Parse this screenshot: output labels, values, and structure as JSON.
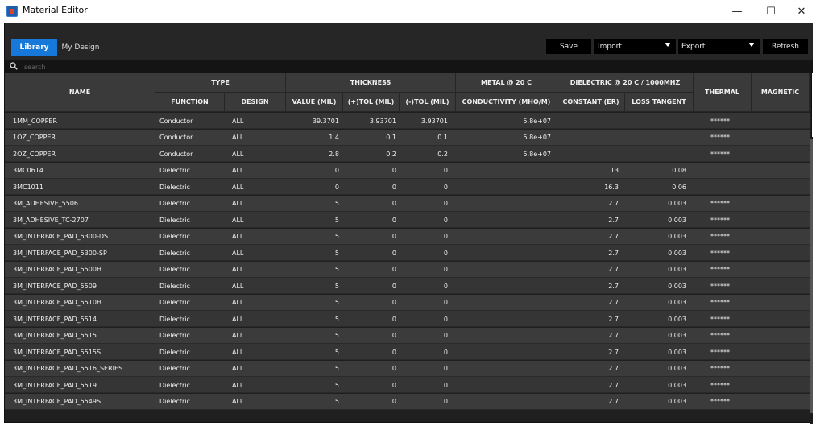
{
  "window": {
    "title": "Material Editor",
    "minimize": "—",
    "maximize": "☐",
    "close": "✕"
  },
  "tabs": [
    {
      "label": "Library"
    },
    {
      "label": "My Design"
    }
  ],
  "toolbar": {
    "save": "Save",
    "import": "Import",
    "export": "Export",
    "refresh": "Refresh"
  },
  "search": {
    "placeholder": "search"
  },
  "header": {
    "name": "NAME",
    "type": "TYPE",
    "thickness": "THICKNESS",
    "metal": "METAL @ 20 C",
    "dielectric": "DIELECTRIC @ 20 C / 1000MHZ",
    "thermal": "THERMAL",
    "magnetic": "MAGNETIC",
    "function": "FUNCTION",
    "design": "DESIGN",
    "value": "VALUE (MIL)",
    "plus_tol": "(+)TOL (MIL)",
    "minus_tol": "(-)TOL (MIL)",
    "conductivity": "CONDUCTIVITY (MHO/M)",
    "constant": "CONSTANT (ER)",
    "loss_tangent": "LOSS TANGENT"
  },
  "rows": [
    {
      "name": "1MM_COPPER",
      "function": "Conductor",
      "design": "ALL",
      "value": "39.3701",
      "plus": "3.93701",
      "minus": "3.93701",
      "cond": "5.8e+07",
      "er": "",
      "loss": "",
      "thermal": "******",
      "magnetic": ""
    },
    {
      "name": "1OZ_COPPER",
      "function": "Conductor",
      "design": "ALL",
      "value": "1.4",
      "plus": "0.1",
      "minus": "0.1",
      "cond": "5.8e+07",
      "er": "",
      "loss": "",
      "thermal": "******",
      "magnetic": ""
    },
    {
      "name": "2OZ_COPPER",
      "function": "Conductor",
      "design": "ALL",
      "value": "2.8",
      "plus": "0.2",
      "minus": "0.2",
      "cond": "5.8e+07",
      "er": "",
      "loss": "",
      "thermal": "******",
      "magnetic": ""
    },
    {
      "name": "3MC0614",
      "function": "Dielectric",
      "design": "ALL",
      "value": "0",
      "plus": "0",
      "minus": "0",
      "cond": "",
      "er": "13",
      "loss": "0.08",
      "thermal": "",
      "magnetic": ""
    },
    {
      "name": "3MC1011",
      "function": "Dielectric",
      "design": "ALL",
      "value": "0",
      "plus": "0",
      "minus": "0",
      "cond": "",
      "er": "16.3",
      "loss": "0.06",
      "thermal": "",
      "magnetic": ""
    },
    {
      "name": "3M_ADHESIVE_5506",
      "function": "Dielectric",
      "design": "ALL",
      "value": "5",
      "plus": "0",
      "minus": "0",
      "cond": "",
      "er": "2.7",
      "loss": "0.003",
      "thermal": "******",
      "magnetic": ""
    },
    {
      "name": "3M_ADHESIVE_TC-2707",
      "function": "Dielectric",
      "design": "ALL",
      "value": "5",
      "plus": "0",
      "minus": "0",
      "cond": "",
      "er": "2.7",
      "loss": "0.003",
      "thermal": "******",
      "magnetic": ""
    },
    {
      "name": "3M_INTERFACE_PAD_5300-DS",
      "function": "Dielectric",
      "design": "ALL",
      "value": "5",
      "plus": "0",
      "minus": "0",
      "cond": "",
      "er": "2.7",
      "loss": "0.003",
      "thermal": "******",
      "magnetic": ""
    },
    {
      "name": "3M_INTERFACE_PAD_5300-SP",
      "function": "Dielectric",
      "design": "ALL",
      "value": "5",
      "plus": "0",
      "minus": "0",
      "cond": "",
      "er": "2.7",
      "loss": "0.003",
      "thermal": "******",
      "magnetic": ""
    },
    {
      "name": "3M_INTERFACE_PAD_5500H",
      "function": "Dielectric",
      "design": "ALL",
      "value": "5",
      "plus": "0",
      "minus": "0",
      "cond": "",
      "er": "2.7",
      "loss": "0.003",
      "thermal": "******",
      "magnetic": ""
    },
    {
      "name": "3M_INTERFACE_PAD_5509",
      "function": "Dielectric",
      "design": "ALL",
      "value": "5",
      "plus": "0",
      "minus": "0",
      "cond": "",
      "er": "2.7",
      "loss": "0.003",
      "thermal": "******",
      "magnetic": ""
    },
    {
      "name": "3M_INTERFACE_PAD_5510H",
      "function": "Dielectric",
      "design": "ALL",
      "value": "5",
      "plus": "0",
      "minus": "0",
      "cond": "",
      "er": "2.7",
      "loss": "0.003",
      "thermal": "******",
      "magnetic": ""
    },
    {
      "name": "3M_INTERFACE_PAD_5514",
      "function": "Dielectric",
      "design": "ALL",
      "value": "5",
      "plus": "0",
      "minus": "0",
      "cond": "",
      "er": "2.7",
      "loss": "0.003",
      "thermal": "******",
      "magnetic": ""
    },
    {
      "name": "3M_INTERFACE_PAD_5515",
      "function": "Dielectric",
      "design": "ALL",
      "value": "5",
      "plus": "0",
      "minus": "0",
      "cond": "",
      "er": "2.7",
      "loss": "0.003",
      "thermal": "******",
      "magnetic": ""
    },
    {
      "name": "3M_INTERFACE_PAD_5515S",
      "function": "Dielectric",
      "design": "ALL",
      "value": "5",
      "plus": "0",
      "minus": "0",
      "cond": "",
      "er": "2.7",
      "loss": "0.003",
      "thermal": "******",
      "magnetic": ""
    },
    {
      "name": "3M_INTERFACE_PAD_5516_SERIES",
      "function": "Dielectric",
      "design": "ALL",
      "value": "5",
      "plus": "0",
      "minus": "0",
      "cond": "",
      "er": "2.7",
      "loss": "0.003",
      "thermal": "******",
      "magnetic": ""
    },
    {
      "name": "3M_INTERFACE_PAD_5519",
      "function": "Dielectric",
      "design": "ALL",
      "value": "5",
      "plus": "0",
      "minus": "0",
      "cond": "",
      "er": "2.7",
      "loss": "0.003",
      "thermal": "******",
      "magnetic": ""
    },
    {
      "name": "3M_INTERFACE_PAD_5549S",
      "function": "Dielectric",
      "design": "ALL",
      "value": "5",
      "plus": "0",
      "minus": "0",
      "cond": "",
      "er": "2.7",
      "loss": "0.003",
      "thermal": "******",
      "magnetic": ""
    }
  ]
}
